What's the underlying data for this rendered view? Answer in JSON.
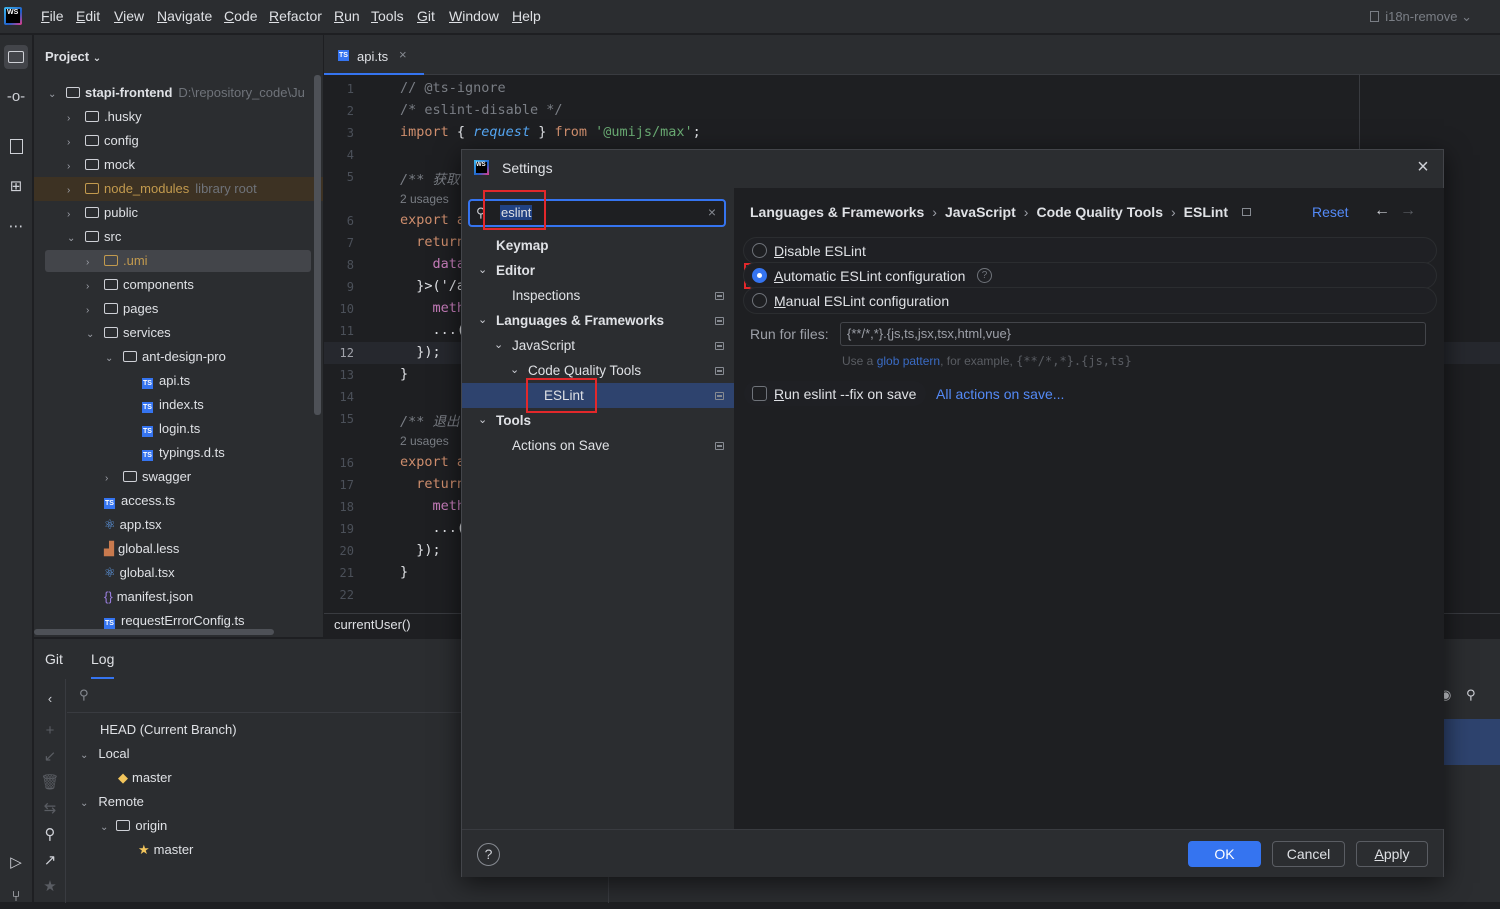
{
  "app": {
    "logo_text": "WS",
    "menus": [
      {
        "label": "File",
        "u": "F",
        "rest": "ile"
      },
      {
        "label": "Edit",
        "u": "E",
        "rest": "dit"
      },
      {
        "label": "View",
        "u": "V",
        "rest": "iew"
      },
      {
        "label": "Navigate",
        "u": "N",
        "rest": "avigate"
      },
      {
        "label": "Code",
        "u": "C",
        "rest": "ode"
      },
      {
        "label": "Refactor",
        "u": "R",
        "rest": "efactor"
      },
      {
        "label": "Run",
        "u": "R",
        "rest": "un"
      },
      {
        "label": "Tools",
        "u": "T",
        "rest": "ools"
      },
      {
        "label": "Git",
        "u": "G",
        "rest": "it"
      },
      {
        "label": "Window",
        "u": "W",
        "rest": "indow"
      },
      {
        "label": "Help",
        "u": "H",
        "rest": "elp"
      }
    ],
    "branch": "i18n-remove"
  },
  "project": {
    "title": "Project",
    "tree": [
      {
        "name": "stapi-frontend",
        "extra": "D:\\repository_code\\Ju",
        "type": "folder",
        "open": true,
        "bold": true
      },
      {
        "name": ".husky",
        "type": "folder"
      },
      {
        "name": "config",
        "type": "folder"
      },
      {
        "name": "mock",
        "type": "folder"
      },
      {
        "name": "node_modules",
        "extra": "library root",
        "type": "folder",
        "excluded": true
      },
      {
        "name": "public",
        "type": "folder"
      },
      {
        "name": "src",
        "type": "folder",
        "open": true
      },
      {
        "name": ".umi",
        "type": "folder",
        "excluded": true,
        "selected": true
      },
      {
        "name": "components",
        "type": "folder"
      },
      {
        "name": "pages",
        "type": "folder"
      },
      {
        "name": "services",
        "type": "folder",
        "open": true
      },
      {
        "name": "ant-design-pro",
        "type": "folder",
        "open": true
      },
      {
        "name": "api.ts",
        "type": "ts"
      },
      {
        "name": "index.ts",
        "type": "ts"
      },
      {
        "name": "login.ts",
        "type": "ts"
      },
      {
        "name": "typings.d.ts",
        "type": "ts"
      },
      {
        "name": "swagger",
        "type": "folder"
      },
      {
        "name": "access.ts",
        "type": "ts"
      },
      {
        "name": "app.tsx",
        "type": "react"
      },
      {
        "name": "global.less",
        "type": "less"
      },
      {
        "name": "global.tsx",
        "type": "react"
      },
      {
        "name": "manifest.json",
        "type": "json"
      },
      {
        "name": "requestErrorConfig.ts",
        "type": "ts"
      }
    ]
  },
  "editor": {
    "tab_label": "api.ts",
    "tab_badge": "TS",
    "line_numbers": [
      "1",
      "2",
      "3",
      "4",
      "5",
      "",
      "6",
      "7",
      "8",
      "9",
      "10",
      "11",
      "12",
      "13",
      "14",
      "15",
      "",
      "16",
      "17",
      "18",
      "19",
      "20",
      "21",
      "22"
    ],
    "lines": {
      "l1": "// @ts-ignore",
      "l2": "/* eslint-disable */",
      "l3_kw": "import",
      "l3_a": " { ",
      "l3_fn": "request",
      "l3_b": " } ",
      "l3_from": "from",
      "l3_str": " '@umijs/max'",
      "l3_end": ";",
      "l5": "/** 获取",
      "u1": "2 usages",
      "l6": "export a",
      "l7": "  return",
      "l8": "    data",
      "l9": "  }>('/a",
      "l10": "    meth",
      "l11": "    ...(",
      "l12": "  });",
      "l13": "}",
      "l15": "/** 退出",
      "u2": "2 usages",
      "l16": "export a",
      "l17": "  return",
      "l18": "    meth",
      "l19": "    ...(",
      "l20": "  });",
      "l21": "}"
    },
    "breadcrumb": "currentUser()"
  },
  "git": {
    "tabs": [
      "Git",
      "Log"
    ],
    "tree": [
      {
        "label": "HEAD (Current Branch)"
      },
      {
        "label": "Local"
      },
      {
        "label": "master"
      },
      {
        "label": "Remote"
      },
      {
        "label": "origin"
      },
      {
        "label": "master"
      }
    ]
  },
  "settings": {
    "title": "Settings",
    "search_value": "eslint",
    "nav": [
      {
        "label": "Keymap",
        "bold": true
      },
      {
        "label": "Editor",
        "bold": true
      },
      {
        "label": "Inspections"
      },
      {
        "label": "Languages & Frameworks",
        "bold": true
      },
      {
        "label": "JavaScript"
      },
      {
        "label": "Code Quality Tools"
      },
      {
        "label": "ESLint",
        "selected": true
      },
      {
        "label": "Tools",
        "bold": true
      },
      {
        "label": "Actions on Save"
      }
    ],
    "breadcrumbs": [
      "Languages & Frameworks",
      "JavaScript",
      "Code Quality Tools",
      "ESLint"
    ],
    "reset_label": "Reset",
    "options": [
      {
        "u": "D",
        "rest": "isable ESLint",
        "checked": false
      },
      {
        "u": "A",
        "rest": "utomatic ESLint configuration",
        "checked": true
      },
      {
        "u": "M",
        "rest": "anual ESLint configuration",
        "checked": false
      }
    ],
    "run_for_files_label": "Run for files:",
    "run_for_files_value": "{**/*,*}.{js,ts,jsx,tsx,html,vue}",
    "hint_a": "Use a ",
    "hint_link": "glob pattern",
    "hint_b": ", for example, ",
    "hint_code": "{**/*,*}.{js,ts}",
    "fix_on_save_label": "Run eslint --fix on save",
    "fix_on_save_checked": false,
    "all_actions_link": "All actions on save...",
    "buttons": {
      "ok": "OK",
      "cancel": "Cancel",
      "apply": "Apply"
    }
  }
}
